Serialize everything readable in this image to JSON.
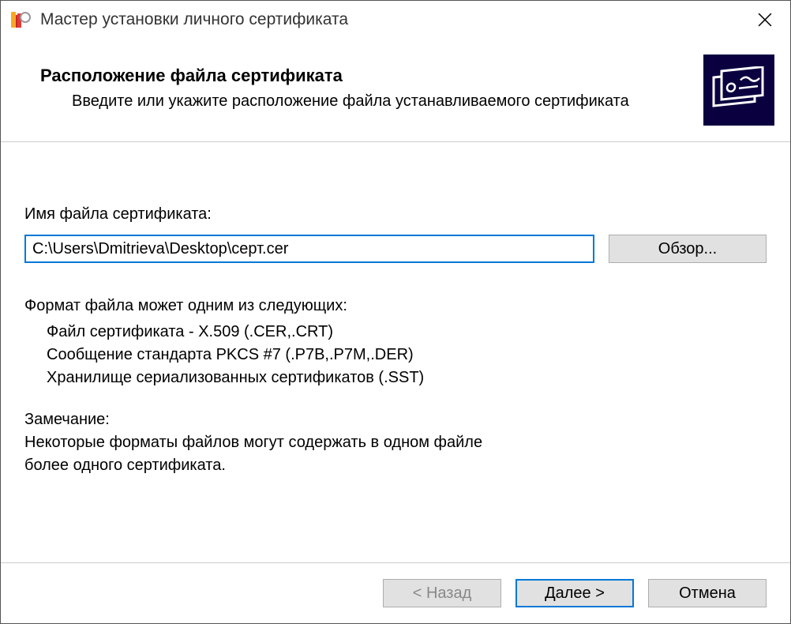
{
  "window": {
    "title": "Мастер установки личного сертификата"
  },
  "header": {
    "title": "Расположение файла сертификата",
    "subtitle": "Введите или укажите расположение файла устанавливаемого сертификата"
  },
  "content": {
    "field_label": "Имя файла сертификата:",
    "path_value": "C:\\Users\\Dmitrieva\\Desktop\\серт.cer",
    "browse_label": "Обзор...",
    "format_title": "Формат файла может одним из следующих:",
    "format_items": [
      "Файл сертификата - X.509 (.CER,.CRT)",
      "Сообщение стандарта PKCS #7 (.P7B,.P7M,.DER)",
      "Хранилище сериализованных сертификатов (.SST)"
    ],
    "note_title": "Замечание:",
    "note_line1": "Некоторые форматы файлов могут содержать в одном файле",
    "note_line2": "более одного сертификата."
  },
  "footer": {
    "back_label": "< Назад",
    "next_label": "Далее >",
    "cancel_label": "Отмена"
  }
}
